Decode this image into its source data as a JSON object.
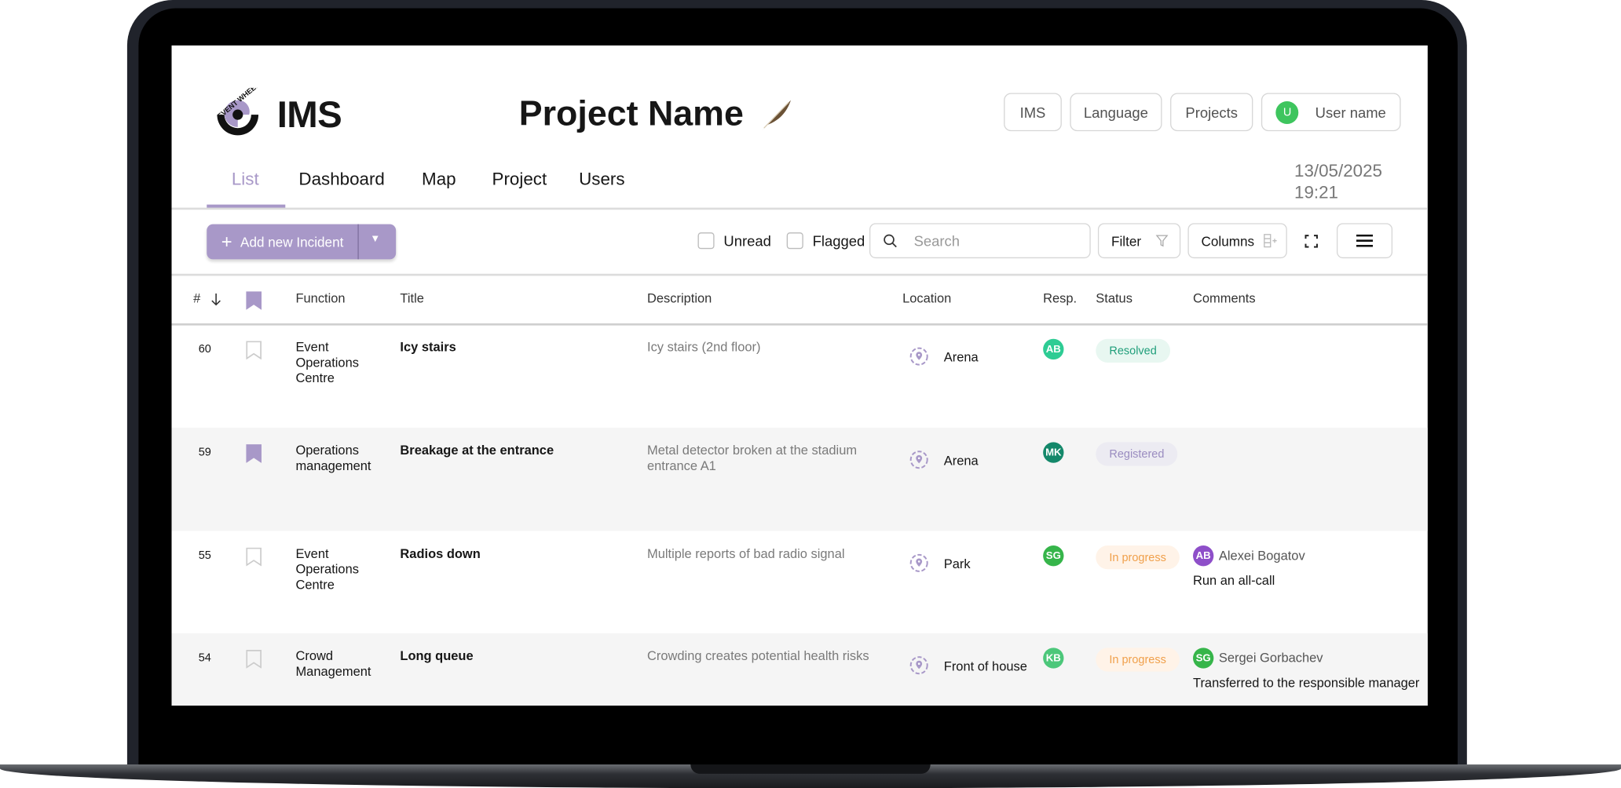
{
  "header": {
    "logo_text": "EVENT WHEEL",
    "app_title": "IMS",
    "project_title": "Project Name",
    "buttons": {
      "ims": "IMS",
      "language": "Language",
      "projects": "Projects"
    },
    "user": {
      "initial": "U",
      "name": "User name",
      "avatar_color": "#3ec55e"
    },
    "date": "13/05/2025",
    "time": "19:21"
  },
  "tabs": [
    {
      "label": "List",
      "active": true
    },
    {
      "label": "Dashboard"
    },
    {
      "label": "Map"
    },
    {
      "label": "Project"
    },
    {
      "label": "Users"
    }
  ],
  "toolbar": {
    "add_label": "Add new Incident",
    "unread_label": "Unread",
    "unread_checked": false,
    "flagged_label": "Flagged",
    "flagged_checked": false,
    "search_placeholder": "Search",
    "filter_label": "Filter",
    "columns_label": "Columns"
  },
  "colors": {
    "accent": "#a898c8",
    "resolved": "#1f9e7a",
    "registered": "#9a8cc0",
    "in_progress": "#f0a04b"
  },
  "table": {
    "headers": {
      "num": "#",
      "function": "Function",
      "title": "Title",
      "description": "Description",
      "location": "Location",
      "resp": "Resp.",
      "status": "Status",
      "comments": "Comments"
    },
    "rows": [
      {
        "num": "60",
        "flagged": false,
        "function": [
          "Event",
          "Operations",
          "Centre"
        ],
        "title": "Icy stairs",
        "description": "Icy stairs (2nd floor)",
        "location": "Arena",
        "resp": "AB",
        "resp_color": "#2ecc94",
        "status": "Resolved",
        "status_type": "resolved"
      },
      {
        "num": "59",
        "flagged": true,
        "function": [
          "Operations",
          "management"
        ],
        "title": "Breakage at the entrance",
        "description": "Metal detector broken at the stadium entrance A1",
        "location": "Arena",
        "resp": "MK",
        "resp_color": "#14886a",
        "status": "Registered",
        "status_type": "registered"
      },
      {
        "num": "55",
        "flagged": false,
        "function": [
          "Event",
          "Operations",
          "Centre"
        ],
        "title": "Radios down",
        "description": "Multiple reports of bad radio signal",
        "location": "Park",
        "resp": "SG",
        "resp_color": "#36b54a",
        "status": "In progress",
        "status_type": "in_progress",
        "comment": {
          "initials": "AB",
          "color": "#8e4fc9",
          "author": "Alexei Bogatov",
          "text": "Run an all-call"
        }
      },
      {
        "num": "54",
        "flagged": false,
        "function": [
          "Crowd",
          "Management"
        ],
        "title": "Long queue",
        "description": "Crowding creates potential health risks",
        "location": "Front of house",
        "resp": "KB",
        "resp_color": "#4cc77a",
        "status": "In progress",
        "status_type": "in_progress",
        "comment": {
          "initials": "SG",
          "color": "#36b54a",
          "author": "Sergei Gorbachev",
          "text": "Transferred to the responsible manager"
        }
      }
    ]
  }
}
